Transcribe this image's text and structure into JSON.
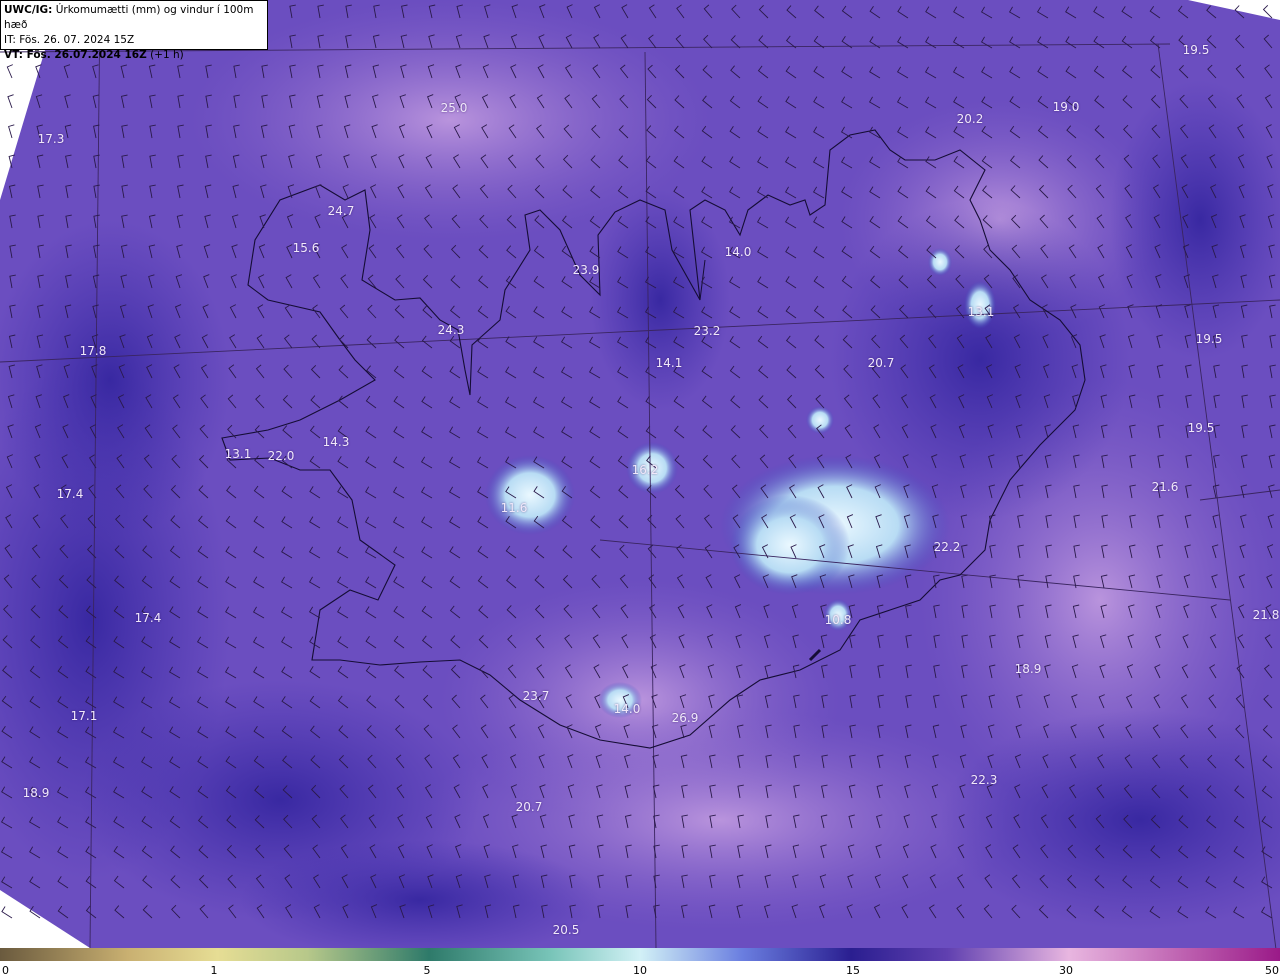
{
  "header": {
    "product": "UWC/IG:",
    "title": "Úrkomumætti (mm) og vindur í 100m hæð",
    "it_label": "IT: Fös. 26. 07. 2024 15Z",
    "vt_bold": "VT: Fös. 26.07.2024 16Z",
    "vt_lead": "(+1 h)"
  },
  "map_values": [
    "25.0",
    "17.3",
    "20.2",
    "19.0",
    "19.5",
    "24.7",
    "15.6",
    "23.9",
    "14.0",
    "17.8",
    "24.3",
    "23.2",
    "14.1",
    "20.7",
    "13.1",
    "19.5",
    "14.3",
    "13.1",
    "22.0",
    "16.2",
    "17.4",
    "19.5",
    "21.6",
    "11.6",
    "22.2",
    "17.4",
    "21.8",
    "10.8",
    "18.9",
    "17.1",
    "23.7",
    "14.0",
    "26.9",
    "22.3",
    "18.9",
    "20.7",
    "20.5"
  ],
  "colorbar": {
    "ticks": [
      "0",
      "1",
      "5",
      "10",
      "15",
      "30",
      "50"
    ]
  }
}
